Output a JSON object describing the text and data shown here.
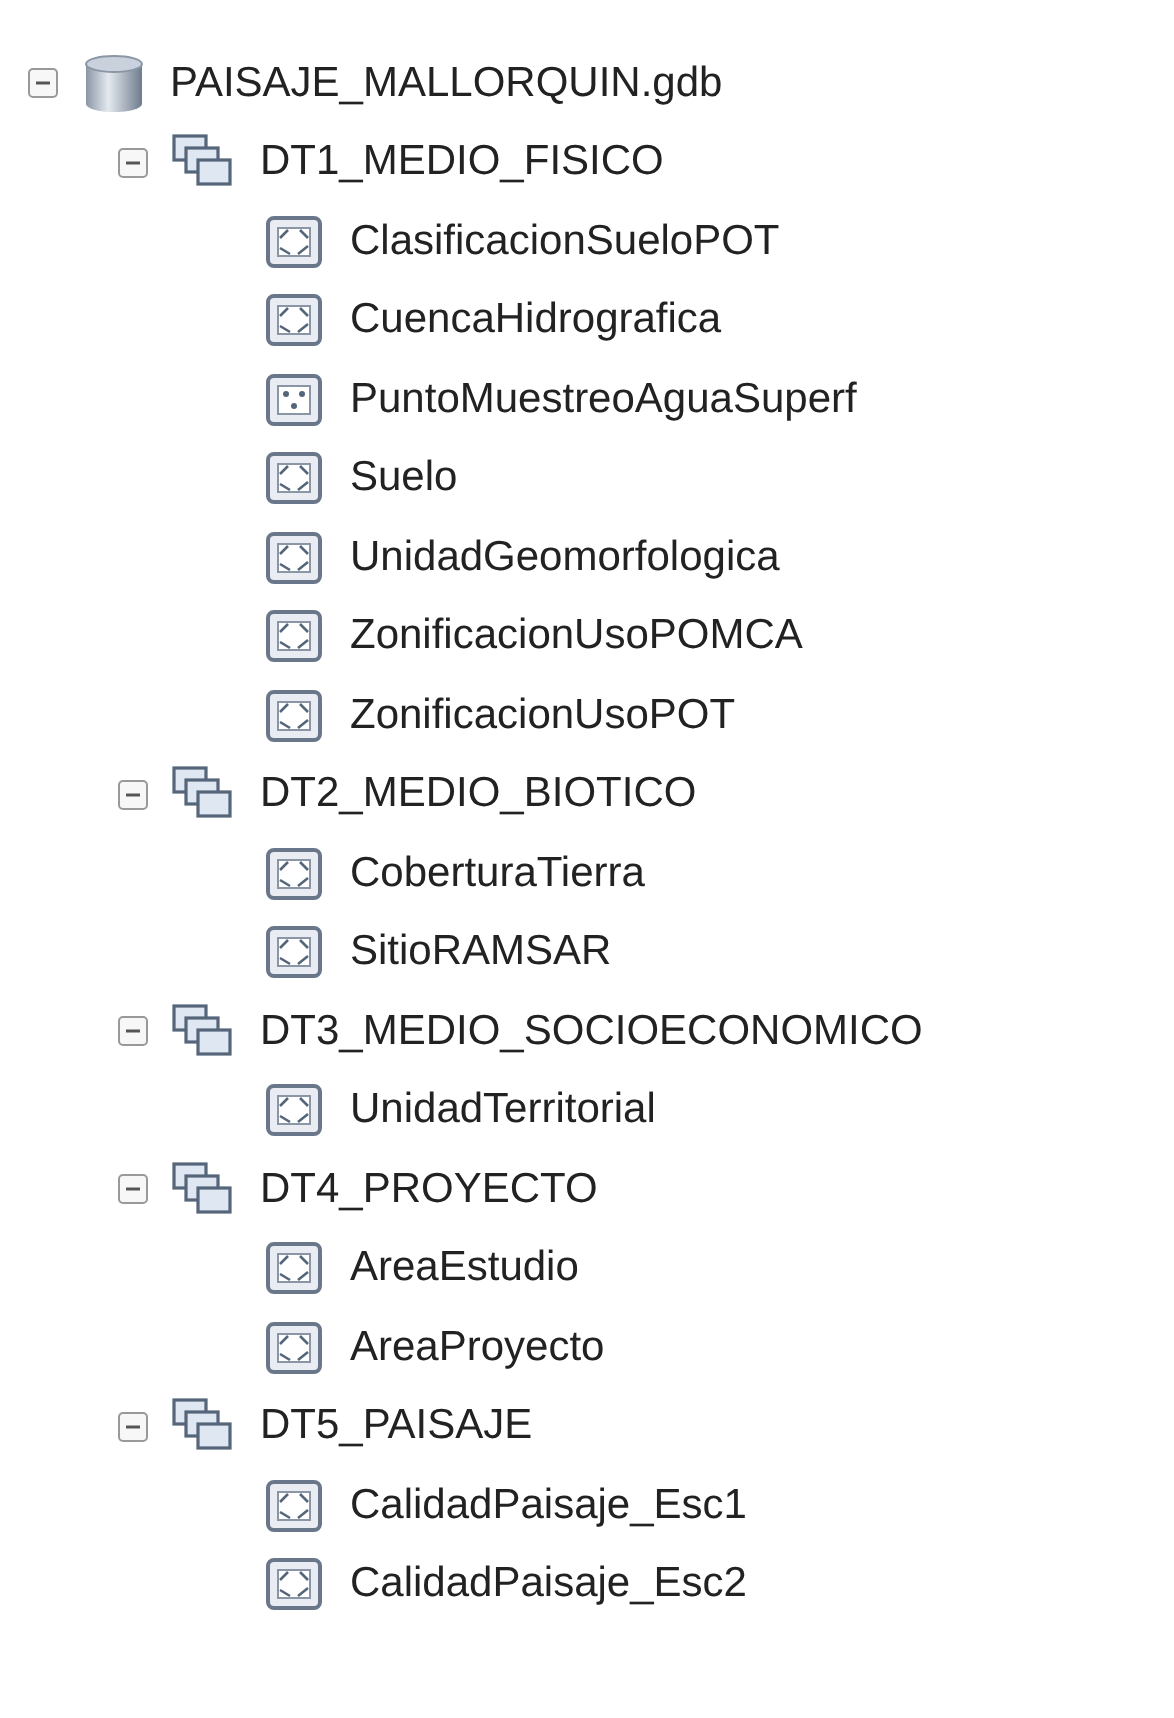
{
  "tree": [
    {
      "label": "PAISAJE_MALLORQUIN.gdb",
      "kind": "geodatabase",
      "expanded": true,
      "children": [
        {
          "label": "DT1_MEDIO_FISICO",
          "kind": "dataset",
          "expanded": true,
          "children": [
            {
              "label": "ClasificacionSueloPOT",
              "kind": "polygon"
            },
            {
              "label": "CuencaHidrografica",
              "kind": "polygon"
            },
            {
              "label": "PuntoMuestreoAguaSuperf",
              "kind": "point"
            },
            {
              "label": "Suelo",
              "kind": "polygon"
            },
            {
              "label": "UnidadGeomorfologica",
              "kind": "polygon"
            },
            {
              "label": "ZonificacionUsoPOMCA",
              "kind": "polygon"
            },
            {
              "label": "ZonificacionUsoPOT",
              "kind": "polygon"
            }
          ]
        },
        {
          "label": "DT2_MEDIO_BIOTICO",
          "kind": "dataset",
          "expanded": true,
          "children": [
            {
              "label": "CoberturaTierra",
              "kind": "polygon"
            },
            {
              "label": "SitioRAMSAR",
              "kind": "polygon"
            }
          ]
        },
        {
          "label": "DT3_MEDIO_SOCIOECONOMICO",
          "kind": "dataset",
          "expanded": true,
          "children": [
            {
              "label": "UnidadTerritorial",
              "kind": "polygon"
            }
          ]
        },
        {
          "label": "DT4_PROYECTO",
          "kind": "dataset",
          "expanded": true,
          "children": [
            {
              "label": "AreaEstudio",
              "kind": "polygon"
            },
            {
              "label": "AreaProyecto",
              "kind": "polygon"
            }
          ]
        },
        {
          "label": "DT5_PAISAJE",
          "kind": "dataset",
          "expanded": true,
          "children": [
            {
              "label": "CalidadPaisaje_Esc1",
              "kind": "polygon"
            },
            {
              "label": "CalidadPaisaje_Esc2",
              "kind": "polygon"
            }
          ]
        }
      ]
    }
  ]
}
